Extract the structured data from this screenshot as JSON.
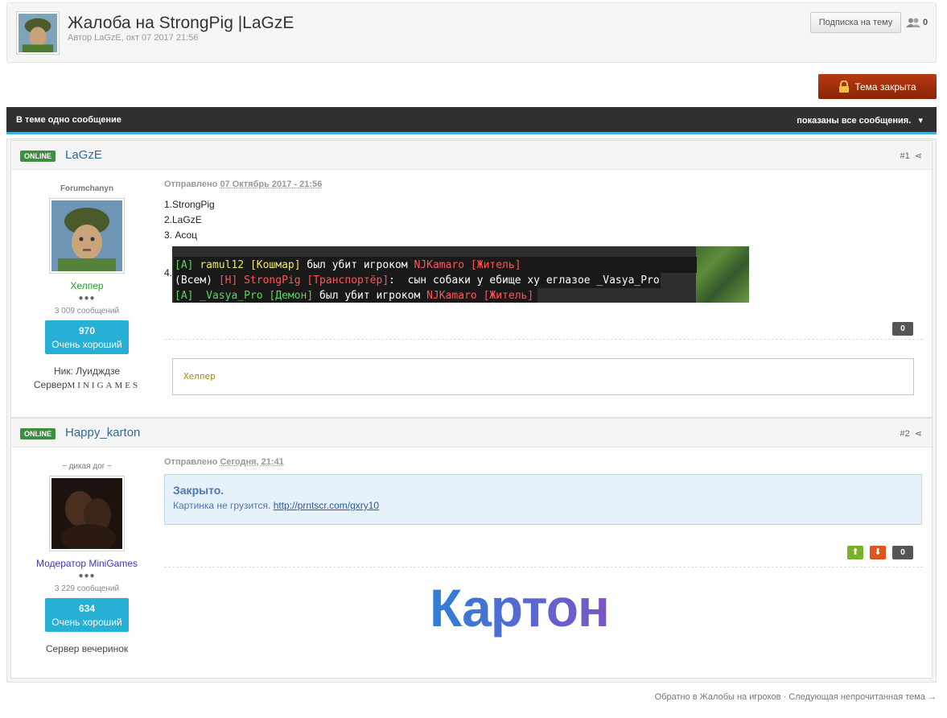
{
  "topic": {
    "title": "Жалоба на StrongPig |LaGzE",
    "meta": "Автор LaGzE, окт 07 2017 21:56",
    "follow_label": "Подписка на тему",
    "followers_count": "0"
  },
  "closed_label": "Тема закрыта",
  "bar": {
    "left": "В теме одно сообщение",
    "right": "показаны все сообщения."
  },
  "posts": [
    {
      "online": "ONLINE",
      "author": "LaGzE",
      "number": "#1",
      "user_title": "Forumchanyn",
      "group": "Хелпер",
      "group_color": "#21a621",
      "dots": "●●●",
      "post_count": "3 009 сообщений",
      "rep_value": "970",
      "rep_label": "Очень хороший",
      "custom_field_1": "Ник: Луидждзе",
      "custom_field_2_label": "Сервер",
      "custom_field_2_value": "MINIGAMES",
      "posted_label": "Отправлено",
      "posted_date": "07 Октябрь 2017 - 21:56",
      "lines": [
        "1.StrongPig",
        "2.LaGzE",
        "3. Асоц"
      ],
      "line4_prefix": "4.",
      "game_lines": [
        {
          "parts": [
            {
              "t": "[A] ",
              "c": "#5fd35f"
            },
            {
              "t": "ramul12 ",
              "c": "#f2e46b"
            },
            {
              "t": "[Кошмар] ",
              "c": "#f2e46b"
            },
            {
              "t": "был убит игроком ",
              "c": "#ffffff"
            },
            {
              "t": "NJKamaro ",
              "c": "#ff5555"
            },
            {
              "t": "[Житель]",
              "c": "#ff5555"
            }
          ]
        },
        {
          "parts": [
            {
              "t": "(Всем) ",
              "c": "#ffffff"
            },
            {
              "t": "[H] ",
              "c": "#ff5555"
            },
            {
              "t": "StrongPig ",
              "c": "#ff5555"
            },
            {
              "t": "[Транспортёр]",
              "c": "#ff5555"
            },
            {
              "t": ":  сын собаки у ебище ху еглазое _Vasya_Pro",
              "c": "#ffffff"
            }
          ]
        },
        {
          "parts": [
            {
              "t": "[A] ",
              "c": "#5fd35f"
            },
            {
              "t": "_Vasya_Pro ",
              "c": "#5fd35f"
            },
            {
              "t": "[Демон] ",
              "c": "#5fd35f"
            },
            {
              "t": "был убит игроком ",
              "c": "#ffffff"
            },
            {
              "t": "NJKamaro ",
              "c": "#ff5555"
            },
            {
              "t": "[Житель]",
              "c": "#ff5555"
            }
          ]
        }
      ],
      "rep_count": "0",
      "signature": "Хелпер"
    },
    {
      "online": "ONLINE",
      "author": "Happy_karton",
      "number": "#2",
      "user_title": "~ дикая дог ~",
      "group": "Модератор MiniGames",
      "group_color": "#3b37b8",
      "dots": "●●●",
      "post_count": "3 229 сообщений",
      "rep_value": "634",
      "rep_label": "Очень хороший",
      "custom_field_1": "Сервер вечеринок",
      "posted_label": "Отправлено",
      "posted_date": "Сегодня, 21:41",
      "mod_title": "Закрыто.",
      "mod_text": "Картинка не грузится.",
      "mod_link": "http://prntscr.com/gxry10",
      "rep_count": "0",
      "signature_logo": "Картон"
    }
  ],
  "footer": {
    "back": "Обратно в Жалобы на игроков",
    "separator": "·",
    "next": "Следующая непрочитанная тема →"
  }
}
